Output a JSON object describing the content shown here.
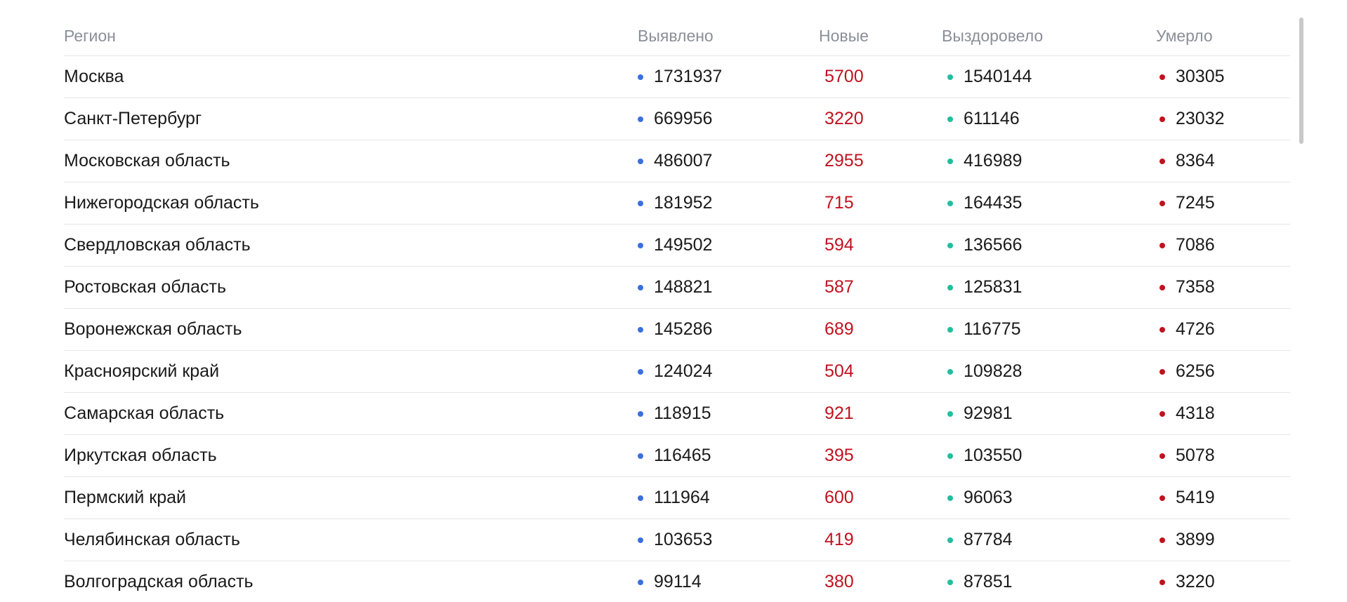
{
  "table": {
    "headers": {
      "region": "Регион",
      "found": "Выявлено",
      "new": "Новые",
      "recovered": "Выздоровело",
      "died": "Умерло"
    },
    "colors": {
      "found_dot": "#3b6fe0",
      "recovered_dot": "#1fbf9f",
      "died_dot": "#c1121f",
      "new_text": "#c1121f"
    },
    "rows": [
      {
        "region": "Москва",
        "found": "1731937",
        "new": "5700",
        "recovered": "1540144",
        "died": "30305"
      },
      {
        "region": "Санкт-Петербург",
        "found": "669956",
        "new": "3220",
        "recovered": "611146",
        "died": "23032"
      },
      {
        "region": "Московская область",
        "found": "486007",
        "new": "2955",
        "recovered": "416989",
        "died": "8364"
      },
      {
        "region": "Нижегородская область",
        "found": "181952",
        "new": "715",
        "recovered": "164435",
        "died": "7245"
      },
      {
        "region": "Свердловская область",
        "found": "149502",
        "new": "594",
        "recovered": "136566",
        "died": "7086"
      },
      {
        "region": "Ростовская область",
        "found": "148821",
        "new": "587",
        "recovered": "125831",
        "died": "7358"
      },
      {
        "region": "Воронежская область",
        "found": "145286",
        "new": "689",
        "recovered": "116775",
        "died": "4726"
      },
      {
        "region": "Красноярский край",
        "found": "124024",
        "new": "504",
        "recovered": "109828",
        "died": "6256"
      },
      {
        "region": "Самарская область",
        "found": "118915",
        "new": "921",
        "recovered": "92981",
        "died": "4318"
      },
      {
        "region": "Иркутская область",
        "found": "116465",
        "new": "395",
        "recovered": "103550",
        "died": "5078"
      },
      {
        "region": "Пермский край",
        "found": "111964",
        "new": "600",
        "recovered": "96063",
        "died": "5419"
      },
      {
        "region": "Челябинская область",
        "found": "103653",
        "new": "419",
        "recovered": "87784",
        "died": "3899"
      },
      {
        "region": "Волгоградская область",
        "found": "99114",
        "new": "380",
        "recovered": "87851",
        "died": "3220"
      }
    ]
  }
}
